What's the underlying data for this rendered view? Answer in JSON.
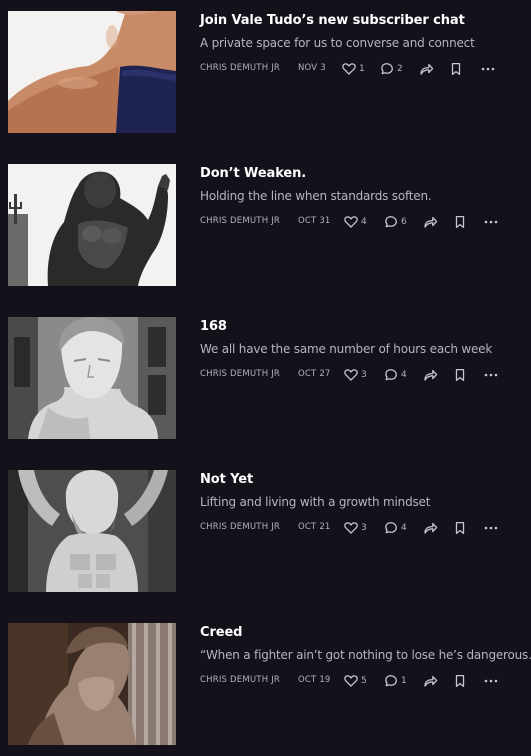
{
  "posts": [
    {
      "title": "Join Vale Tudo’s new subscriber chat",
      "subtitle": "A private space for us to converse and connect",
      "author": "CHRIS DEMUTH JR",
      "date": "NOV 3",
      "likes": "1",
      "comments": "2",
      "image": "flexed-bicep-photo"
    },
    {
      "title": "Don’t Weaken.",
      "subtitle": "Holding the line when standards soften.",
      "author": "CHRIS DEMUTH JR",
      "date": "OCT 31",
      "likes": "4",
      "comments": "6",
      "image": "neptune-statue-photo"
    },
    {
      "title": "168",
      "subtitle": "We all have the same number of hours each week",
      "author": "CHRIS DEMUTH JR",
      "date": "OCT 27",
      "likes": "3",
      "comments": "4",
      "image": "marble-statue-head-photo"
    },
    {
      "title": "Not Yet",
      "subtitle": "Lifting and living with a growth mindset",
      "author": "CHRIS DEMUTH JR",
      "date": "OCT 21",
      "likes": "3",
      "comments": "4",
      "image": "atlas-statue-photo"
    },
    {
      "title": "Creed",
      "subtitle": "“When a fighter ain’t got nothing to lose he’s dangerous.”",
      "author": "CHRIS DEMUTH JR",
      "date": "OCT 19",
      "likes": "5",
      "comments": "1",
      "image": "david-statue-photo"
    }
  ],
  "icons": {
    "like": "heart-icon",
    "comment": "comment-bubble-icon",
    "share": "share-arrow-icon",
    "bookmark": "bookmark-icon",
    "more": "more-dots-icon"
  },
  "colors": {
    "background": "#14111a",
    "title": "#ffffff",
    "subtitle": "#b8b4c0",
    "meta": "#b4b0bb"
  }
}
